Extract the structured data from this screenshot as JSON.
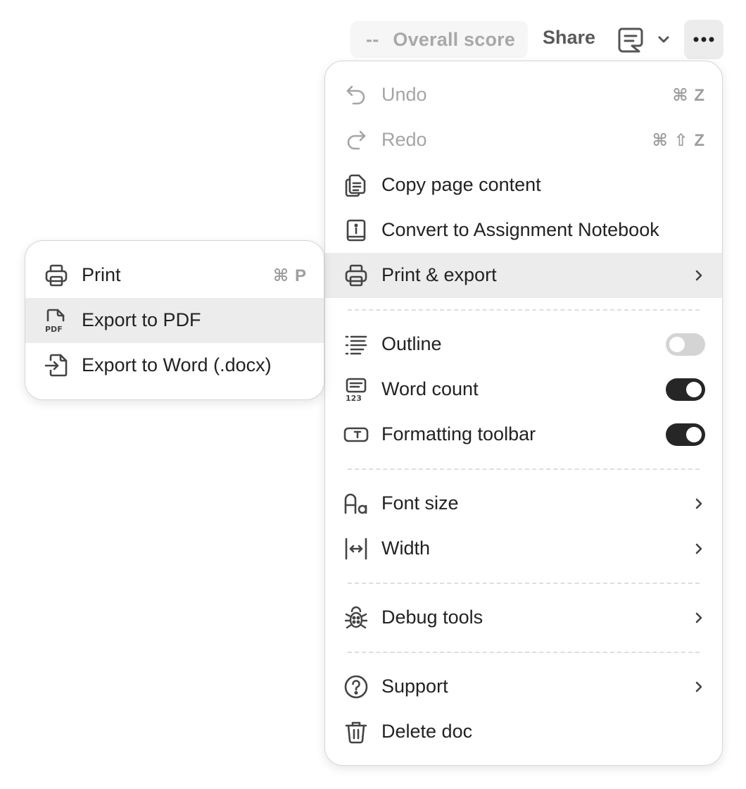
{
  "topbar": {
    "score_dash": "--",
    "score_label": "Overall score",
    "share_label": "Share"
  },
  "menu": {
    "undo": {
      "label": "Undo",
      "shortcut": "⌘ Z"
    },
    "redo": {
      "label": "Redo",
      "shortcut": "⌘ ⇧ Z"
    },
    "copy": {
      "label": "Copy page content"
    },
    "convert": {
      "label": "Convert to Assignment Notebook"
    },
    "print_export": {
      "label": "Print & export"
    },
    "outline": {
      "label": "Outline",
      "enabled": false
    },
    "word_count": {
      "label": "Word count",
      "enabled": true
    },
    "formatting_toolbar": {
      "label": "Formatting toolbar",
      "enabled": true
    },
    "font_size": {
      "label": "Font size"
    },
    "width": {
      "label": "Width"
    },
    "debug": {
      "label": "Debug tools"
    },
    "support": {
      "label": "Support"
    },
    "delete": {
      "label": "Delete doc"
    }
  },
  "submenu": {
    "print": {
      "label": "Print",
      "shortcut": "⌘ P"
    },
    "pdf": {
      "label": "Export to PDF"
    },
    "word": {
      "label": "Export to Word (.docx)"
    }
  }
}
